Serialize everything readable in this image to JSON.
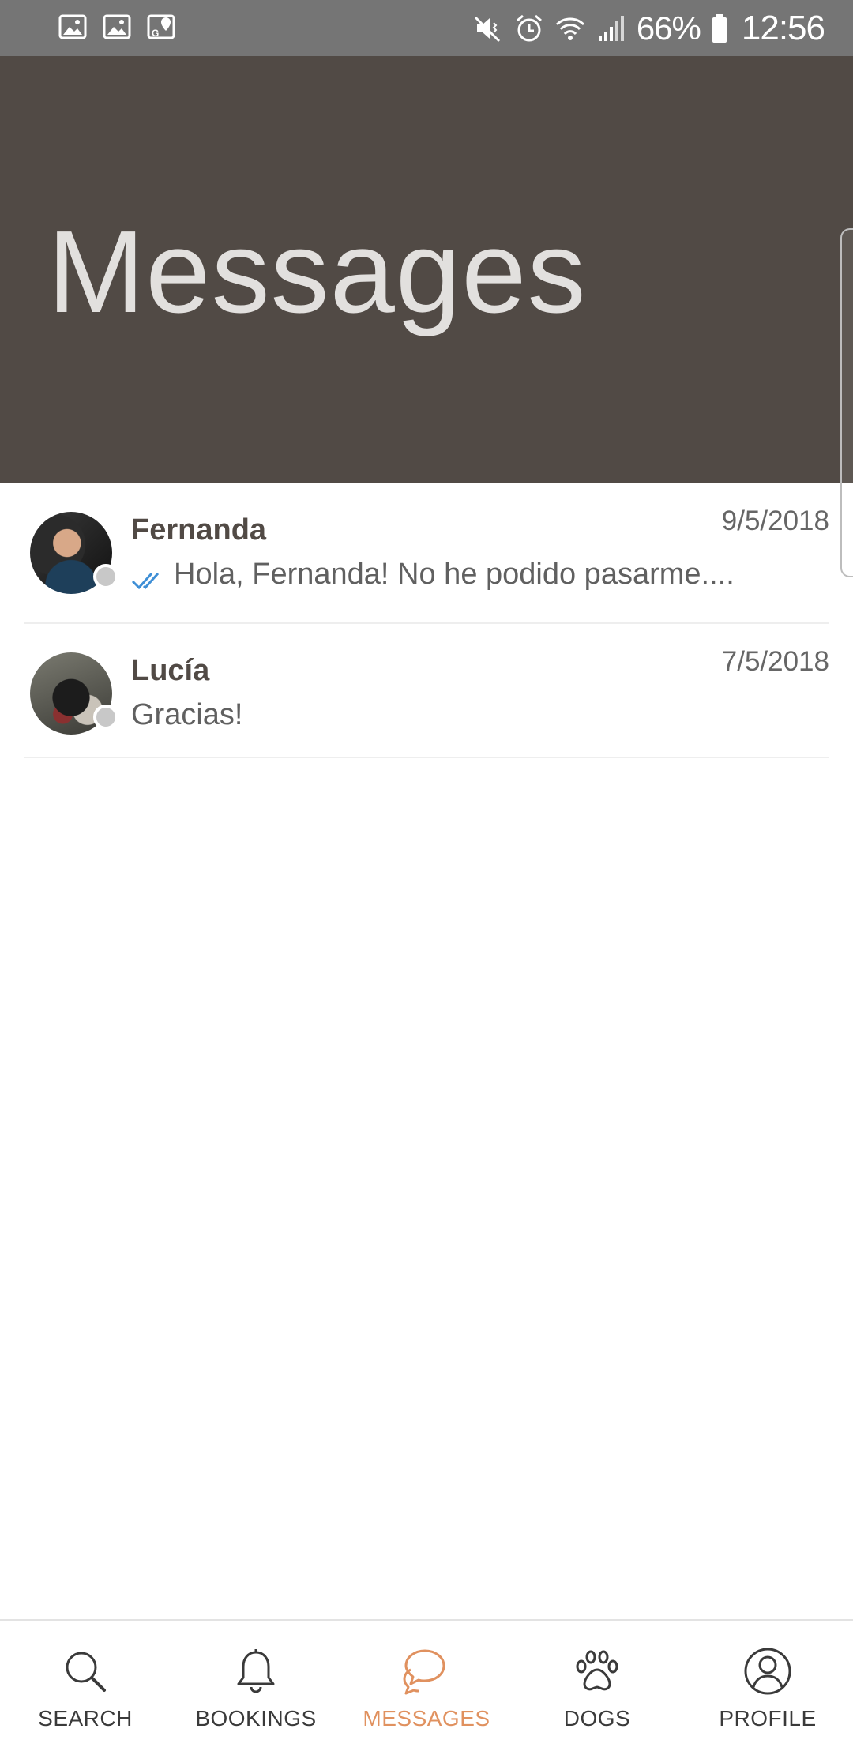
{
  "status_bar": {
    "battery": "66%",
    "time": "12:56",
    "left_icons": [
      "image-icon",
      "image-icon",
      "maps-icon"
    ],
    "right_icons": [
      "mute-icon",
      "alarm-icon",
      "wifi-icon",
      "signal-icon",
      "battery-icon"
    ]
  },
  "header": {
    "title": "Messages"
  },
  "conversations": [
    {
      "name": "Fernanda",
      "date": "9/5/2018",
      "preview": "Hola, Fernanda! No he podido pasarme....",
      "read_receipt": true
    },
    {
      "name": "Lucía",
      "date": "7/5/2018",
      "preview": "Gracias!",
      "read_receipt": false
    }
  ],
  "bottom_nav": {
    "items": [
      {
        "label": "SEARCH",
        "icon": "search-icon",
        "active": false
      },
      {
        "label": "BOOKINGS",
        "icon": "bell-icon",
        "active": false
      },
      {
        "label": "MESSAGES",
        "icon": "chat-bubbles-icon",
        "active": true
      },
      {
        "label": "DOGS",
        "icon": "paw-icon",
        "active": false
      },
      {
        "label": "PROFILE",
        "icon": "profile-icon",
        "active": false
      }
    ]
  },
  "colors": {
    "header_bg": "#514a45",
    "status_bar_bg": "#757575",
    "accent": "#e0915f",
    "read_check": "#3f8fd6"
  }
}
